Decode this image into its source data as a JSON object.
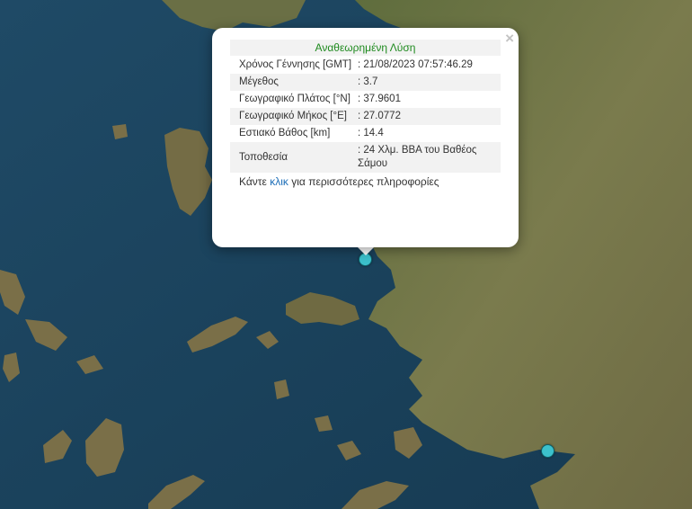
{
  "popup": {
    "title": "Αναθεωρημένη Λύση",
    "close": "×",
    "rows": [
      {
        "label": "Χρόνος Γέννησης [GMT]",
        "value": ": 21/08/2023 07:57:46.29"
      },
      {
        "label": "Μέγεθος",
        "value": ": 3.7"
      },
      {
        "label": "Γεωγραφικό Πλάτος [°N]",
        "value": ": 37.9601"
      },
      {
        "label": "Γεωγραφικό Μήκος [°E]",
        "value": ": 27.0772"
      },
      {
        "label": "Εστιακό Βάθος [km]",
        "value": ": 14.4"
      },
      {
        "label": "Τοποθεσία",
        "value": ": 24 Χλμ. ΒΒΑ του Βαθέος Σάμου"
      }
    ],
    "more_prefix": "Κάντε",
    "more_link": "κλικ",
    "more_suffix": "για περισσότερες πληροφορίες"
  },
  "colors": {
    "sea": "#1b4560",
    "land": "#6b7a45",
    "marker": "#3cc1cc",
    "title": "#1e8a1e",
    "link": "#1e6fb8"
  },
  "markers": [
    {
      "name": "earthquake-marker-selected",
      "icon": "circle-marker"
    },
    {
      "name": "earthquake-marker",
      "icon": "circle-marker"
    }
  ]
}
